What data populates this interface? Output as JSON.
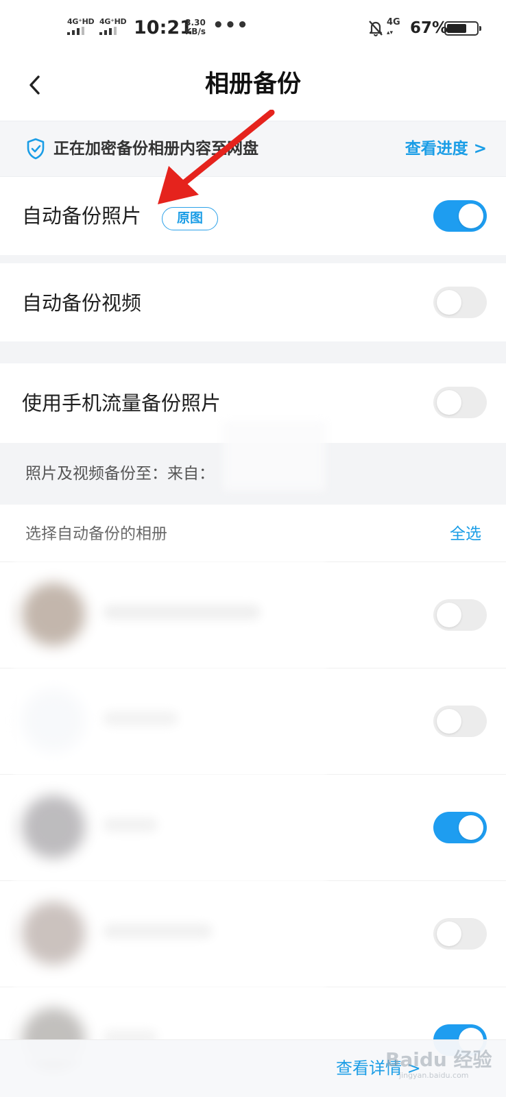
{
  "status_bar": {
    "sim1": "4G⁺HD",
    "sim2": "4G⁺HD",
    "time": "10:21",
    "speed_value": "3.30",
    "speed_unit": "KB/s",
    "more": "•••",
    "net": "4G",
    "battery_percent": "67%",
    "battery_level": 0.67,
    "icons": [
      "signal-icon",
      "mute-bell-icon",
      "battery-icon"
    ]
  },
  "header": {
    "title": "相册备份",
    "back_icon": "chevron-left-icon"
  },
  "notice": {
    "text": "正在加密备份相册内容至网盘",
    "link": "查看进度 >",
    "icon": "shield-check-icon"
  },
  "settings": [
    {
      "label": "自动备份照片",
      "badge": "原图",
      "on": true
    },
    {
      "label": "自动备份视频",
      "on": false
    },
    {
      "label": "使用手机流量备份照片",
      "on": false
    }
  ],
  "backup_target": "照片及视频备份至：来自：",
  "albums_section": {
    "title": "选择自动备份的相册",
    "select_all": "全选",
    "albums": [
      {
        "on": false
      },
      {
        "on": false
      },
      {
        "on": true
      },
      {
        "on": false
      },
      {
        "on": true
      }
    ]
  },
  "bottom_bar": {
    "link": "查看详情 >"
  },
  "watermark": {
    "text": "Baidu 经验",
    "sub": "jingyan.baidu.com"
  },
  "colors": {
    "accent": "#1e9df0",
    "link": "#1a9de6",
    "arrow": "#e5231d"
  }
}
